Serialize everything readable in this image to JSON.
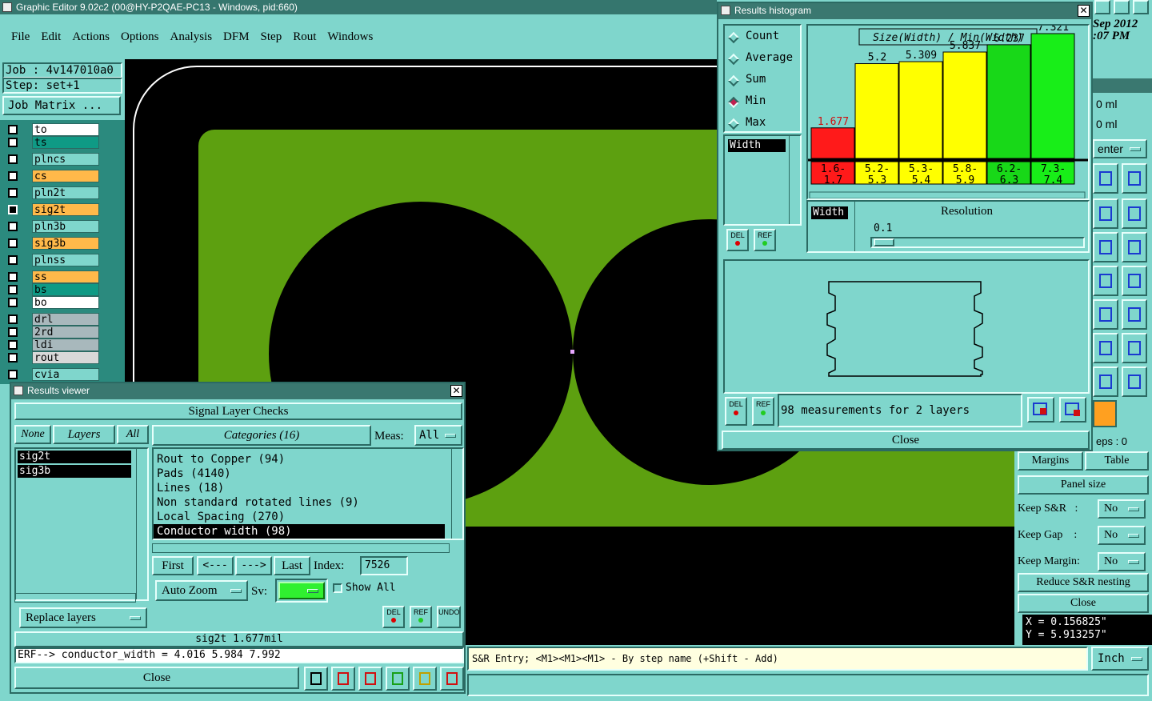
{
  "app": {
    "title": "Graphic Editor 9.02c2 (00@HY-P2QAE-PC13 - Windows, pid:660)"
  },
  "menu": [
    "File",
    "Edit",
    "Actions",
    "Options",
    "Analysis",
    "DFM",
    "Step",
    "Rout",
    "Windows"
  ],
  "job": {
    "job_label": "Job : 4v147010a0",
    "step_label": "Step: set+1",
    "matrix_button": "Job Matrix ..."
  },
  "layers": [
    {
      "name": "to",
      "color": "#ffffff"
    },
    {
      "name": "ts",
      "color": "#0f9a85"
    },
    {
      "name": "plncs",
      "color": "#7fd6cc"
    },
    {
      "name": "cs",
      "color": "#ffb94a"
    },
    {
      "name": "pln2t",
      "color": "#7fd6cc"
    },
    {
      "name": "sig2t",
      "color": "#ffb94a"
    },
    {
      "name": "pln3b",
      "color": "#7fd6cc"
    },
    {
      "name": "sig3b",
      "color": "#ffb94a"
    },
    {
      "name": "plnss",
      "color": "#7fd6cc"
    },
    {
      "name": "ss",
      "color": "#ffb94a"
    },
    {
      "name": "bs",
      "color": "#0f9a85"
    },
    {
      "name": "bo",
      "color": "#ffffff"
    },
    {
      "name": "drl",
      "color": "#a8b8bc"
    },
    {
      "name": "2rd",
      "color": "#a8b8bc"
    },
    {
      "name": "ldi",
      "color": "#a8b8bc"
    },
    {
      "name": "rout",
      "color": "#d8d8d8"
    },
    {
      "name": "cvia",
      "color": "#7fd6cc"
    }
  ],
  "clock": {
    "date": "Sep 2012",
    "time": ":07 PM"
  },
  "results_viewer": {
    "title": "Results viewer",
    "section": "Signal Layer Checks",
    "none_btn": "None",
    "layers_btn": "Layers",
    "all_btn": "All",
    "categories_label": "Categories (16)",
    "meas_label": "Meas:",
    "meas_value": "All",
    "layer_list": [
      "sig2t",
      "sig3b"
    ],
    "categories": [
      "Rout to Copper (94)",
      "Pads (4140)",
      "Lines (18)",
      "Non standard rotated lines (9)",
      "Local Spacing (270)",
      "Conductor width (98)"
    ],
    "selected_category": 5,
    "first_btn": "First",
    "prev_btn": "<---",
    "next_btn": "--->",
    "last_btn": "Last",
    "index_label": "Index:",
    "index_value": "7526",
    "autozoom": "Auto Zoom",
    "sv_label": "Sv:",
    "show_all": "Show All",
    "replace_layers": "Replace layers",
    "del": "DEL",
    "ref": "REF",
    "undo": "UNDO",
    "status": "sig2t 1.677mil",
    "erf": "ERF--> conductor_width = 4.016 5.984 7.992",
    "close": "Close"
  },
  "histogram": {
    "title": "Results histogram",
    "modes": [
      "Count",
      "Average",
      "Sum",
      "Min",
      "Max"
    ],
    "selected_mode": "Min",
    "chart_title": "Size(Width) / Min(Width)",
    "field": "Width",
    "del": "DEL",
    "ref": "REF",
    "resolution_label": "Resolution",
    "resolution_value": "0.1",
    "measurements": "98 measurements for 2 layers",
    "close": "Close"
  },
  "chart_data": {
    "type": "bar",
    "title": "Size(Width) / Min(Width)",
    "categories": [
      "1.6-1.7",
      "5.2-5.3",
      "5.3-5.4",
      "5.8-5.9",
      "6.2-6.3",
      "7.3-7.4"
    ],
    "values": [
      1.677,
      5.2,
      5.309,
      5.837,
      6.237,
      7.321
    ],
    "value_labels": [
      "1.677",
      "5.2",
      "5.309",
      "5.837",
      "6.237",
      "7.321"
    ],
    "colors": [
      "#ff1a1a",
      "#ffff00",
      "#ffff00",
      "#ffff00",
      "#18d818",
      "#18ee18"
    ],
    "category_colors": [
      "#ff1a1a",
      "#ffff00",
      "#ffff00",
      "#ffff00",
      "#18d818",
      "#18ee18"
    ],
    "ylim": [
      0,
      7.9
    ]
  },
  "right_panel": {
    "partial1": "o",
    "ml1": "0 ml",
    "ml2": "0 ml",
    "center": "enter",
    "steps": "eps : 0",
    "margins": "Margins",
    "table": "Table",
    "panel_size": "Panel size",
    "keep_sr": "Keep S&R   :",
    "keep_gap": "Keep Gap    :",
    "keep_margin": "Keep Margin:",
    "no": "No",
    "reduce": "Reduce S&R nesting",
    "close": "Close",
    "x": "X = 0.156825\"",
    "y": "Y = 5.913257\""
  },
  "statusbar": {
    "message": "S&R Entry; <M1><M1><M1> - By step name (+Shift - Add)",
    "units": "Inch"
  }
}
